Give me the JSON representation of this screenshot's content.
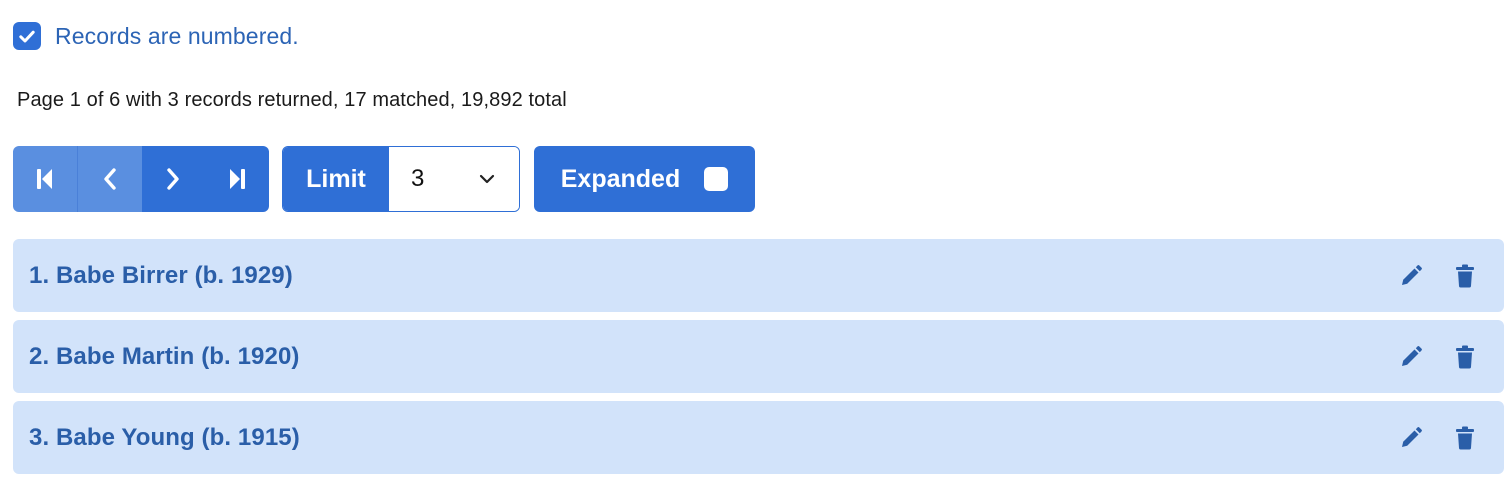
{
  "options": {
    "numbered_label": "Records are numbered.",
    "numbered_checked": true
  },
  "summary": "Page 1 of 6 with 3 records returned, 17 matched, 19,892 total",
  "toolbar": {
    "pager_icons": [
      "first-page-icon",
      "previous-page-icon",
      "next-page-icon",
      "last-page-icon"
    ],
    "limit_label": "Limit",
    "limit_value": "3",
    "expanded_label": "Expanded",
    "expanded_checked": false
  },
  "records": [
    {
      "title": "1. Babe Birrer (b. 1929)"
    },
    {
      "title": "2. Babe Martin (b. 1920)"
    },
    {
      "title": "3. Babe Young (b. 1915)"
    }
  ],
  "colors": {
    "primary": "#2f6fd6",
    "primary_disabled": "#5a8fe0",
    "record_bg": "#d2e3fa",
    "record_text": "#2a5ea8"
  }
}
